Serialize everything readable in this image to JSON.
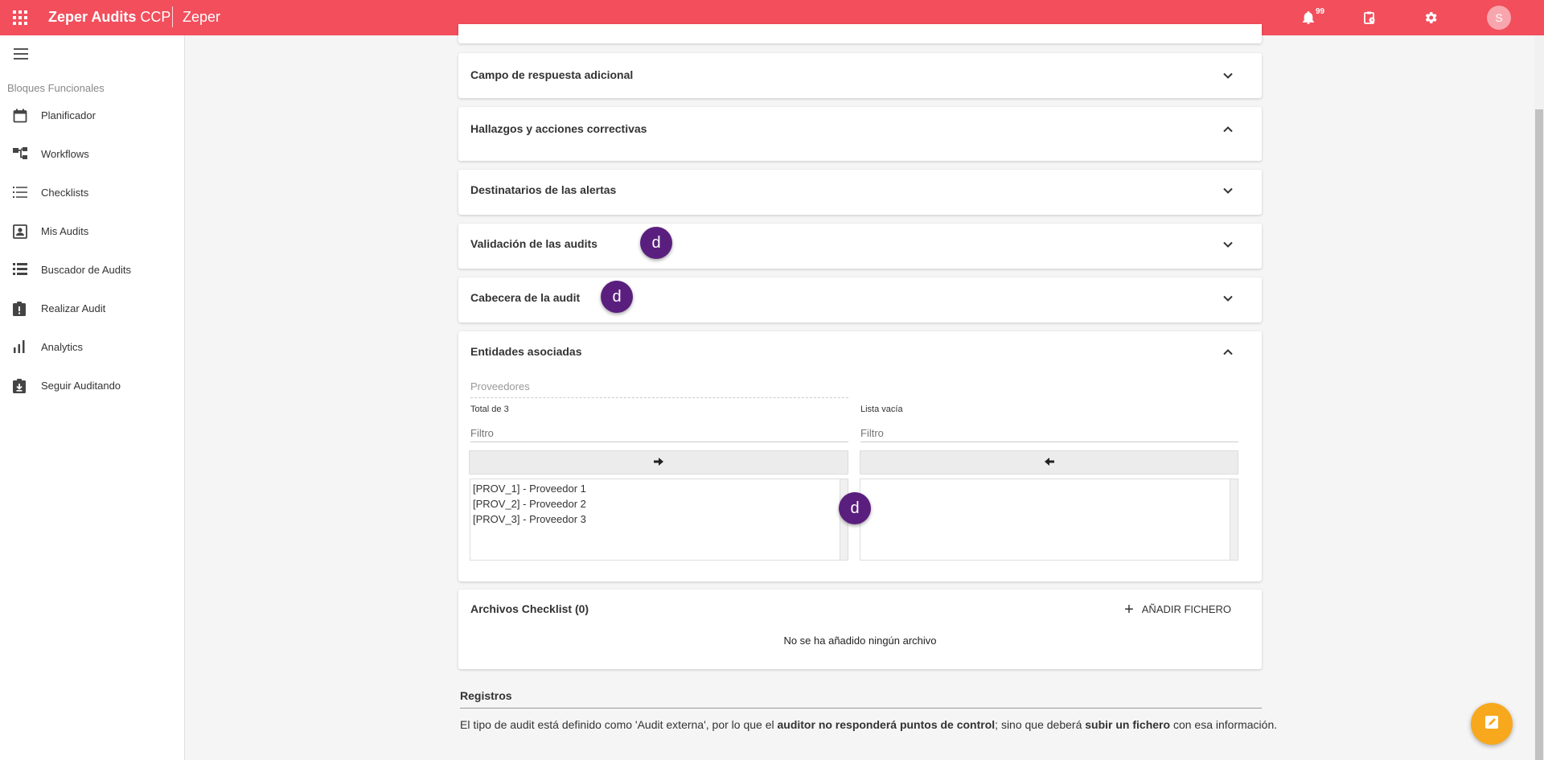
{
  "header": {
    "app_name": "Zeper Audits",
    "app_suffix": "CCP",
    "organization": "Zeper",
    "notifications_count": "99",
    "avatar_initial": "S",
    "brand_color": "#f24e5c"
  },
  "sidebar": {
    "section_label": "Bloques Funcionales",
    "items": [
      {
        "label": "Planificador",
        "icon": "calendar-icon"
      },
      {
        "label": "Workflows",
        "icon": "workflow-icon"
      },
      {
        "label": "Checklists",
        "icon": "checklist-icon"
      },
      {
        "label": "Mis Audits",
        "icon": "contact-card-icon"
      },
      {
        "label": "Buscador de Audits",
        "icon": "list-search-icon"
      },
      {
        "label": "Realizar Audit",
        "icon": "clipboard-alert-icon"
      },
      {
        "label": "Analytics",
        "icon": "bar-chart-icon"
      },
      {
        "label": "Seguir Auditando",
        "icon": "clipboard-download-icon"
      }
    ]
  },
  "panels": {
    "campo_respuesta": {
      "title": "Campo de respuesta adicional",
      "expanded": false
    },
    "hallazgos": {
      "title": "Hallazgos y acciones correctivas",
      "expanded": true
    },
    "destinatarios": {
      "title": "Destinatarios de las alertas",
      "expanded": false
    },
    "validacion": {
      "title": "Validación de las audits",
      "expanded": false
    },
    "cabecera": {
      "title": "Cabecera de la audit",
      "expanded": false
    },
    "entidades": {
      "title": "Entidades asociadas",
      "expanded": true,
      "field_label": "Proveedores",
      "left_total": "Total de 3",
      "right_total": "Lista vacía",
      "filter_placeholder": "Filtro",
      "left_items": [
        "[PROV_1] - Proveedor 1",
        "[PROV_2] - Proveedor 2",
        "[PROV_3] - Proveedor 3"
      ],
      "right_items": []
    },
    "archivos": {
      "title": "Archivos Checklist (0)",
      "add_label": "AÑADIR FICHERO",
      "empty_text": "No se ha añadido ningún archivo"
    }
  },
  "step_marker": "d",
  "registros": {
    "title": "Registros",
    "text_part1": "El tipo de audit está definido como 'Audit externa', por lo que el ",
    "text_bold1": "auditor no responderá puntos de control",
    "text_part2": "; sino que deberá ",
    "text_bold2": "subir un fichero",
    "text_part3": " con esa información."
  },
  "fab_color": "#f7a81d"
}
